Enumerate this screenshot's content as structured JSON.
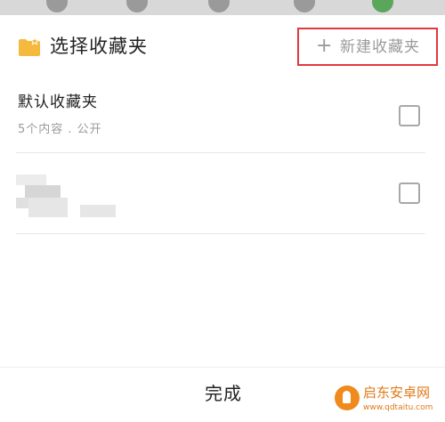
{
  "header": {
    "title": "选择收藏夹",
    "new_folder_label": "新建收藏夹",
    "new_folder_icon": "+",
    "highlight_color": "#e0393e",
    "folder_icon_color": "#f5b93e"
  },
  "collections": [
    {
      "name": "默认收藏夹",
      "meta": "5个内容 . 公开",
      "checked": false
    },
    {
      "name": "",
      "meta": "",
      "checked": false,
      "blurred": true
    }
  ],
  "footer": {
    "done_label": "完成"
  },
  "watermark": {
    "title": "启东安卓网",
    "url": "www.qdtaitu.com"
  }
}
